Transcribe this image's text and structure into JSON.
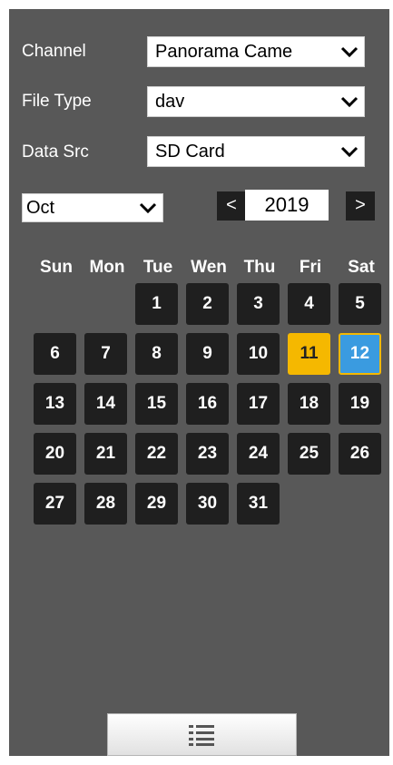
{
  "filters": {
    "channel_label": "Channel",
    "channel_value": "Panorama Came",
    "file_type_label": "File Type",
    "file_type_value": "dav",
    "data_src_label": "Data Src",
    "data_src_value": "SD Card"
  },
  "calendar": {
    "month": "Oct",
    "year": "2019",
    "prev_glyph": "<",
    "next_glyph": ">",
    "weekdays": [
      "Sun",
      "Mon",
      "Tue",
      "Wen",
      "Thu",
      "Fri",
      "Sat"
    ],
    "days": [
      "1",
      "2",
      "3",
      "4",
      "5",
      "6",
      "7",
      "8",
      "9",
      "10",
      "11",
      "12",
      "13",
      "14",
      "15",
      "16",
      "17",
      "18",
      "19",
      "20",
      "21",
      "22",
      "23",
      "24",
      "25",
      "26",
      "27",
      "28",
      "29",
      "30",
      "31"
    ],
    "today": "11",
    "selected": "12"
  },
  "icons": {
    "dropdown": "chevron-down-icon",
    "list_button": "list-icon"
  },
  "colors": {
    "panel_bg": "#585858",
    "day_bg": "#1f1f1f",
    "today_bg": "#f5b800",
    "selected_bg": "#3a9be0",
    "selected_border": "#f5b800"
  }
}
